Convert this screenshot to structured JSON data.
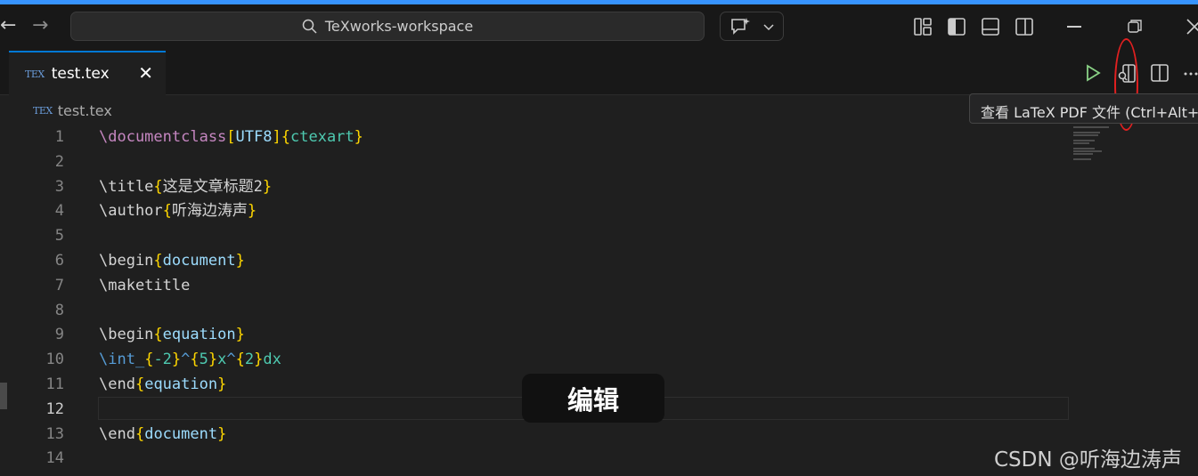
{
  "titlebar": {
    "search_text": "TeXworks-workspace",
    "accent_color": "#3794ff"
  },
  "tab": {
    "badge": "TEX",
    "label": "test.tex",
    "close_glyph": "✕",
    "accent_color": "#0078d4"
  },
  "breadcrumb": {
    "badge": "TEX",
    "file": "test.tex"
  },
  "tooltip": {
    "text": "查看 LaTeX PDF 文件 (Ctrl+Alt+V"
  },
  "code": {
    "lines": [
      {
        "n": "1",
        "segments": [
          [
            "kw",
            "\\documentclass"
          ],
          [
            "br",
            "["
          ],
          [
            "arg",
            "UTF8"
          ],
          [
            "br",
            "]"
          ],
          [
            "br",
            "{"
          ],
          [
            "cls",
            "ctexart"
          ],
          [
            "br",
            "}"
          ]
        ]
      },
      {
        "n": "2",
        "segments": []
      },
      {
        "n": "3",
        "segments": [
          [
            "cmd",
            "\\title"
          ],
          [
            "br",
            "{"
          ],
          [
            "txt",
            "这是文章标题2"
          ],
          [
            "br",
            "}"
          ]
        ]
      },
      {
        "n": "4",
        "segments": [
          [
            "cmd",
            "\\author"
          ],
          [
            "br",
            "{"
          ],
          [
            "txt",
            "听海边涛声"
          ],
          [
            "br",
            "}"
          ]
        ]
      },
      {
        "n": "5",
        "segments": []
      },
      {
        "n": "6",
        "segments": [
          [
            "cmd",
            "\\begin"
          ],
          [
            "br",
            "{"
          ],
          [
            "arg",
            "document"
          ],
          [
            "br",
            "}"
          ]
        ]
      },
      {
        "n": "7",
        "segments": [
          [
            "cmd",
            "\\maketitle"
          ]
        ]
      },
      {
        "n": "8",
        "segments": []
      },
      {
        "n": "9",
        "segments": [
          [
            "cmd",
            "\\begin"
          ],
          [
            "br",
            "{"
          ],
          [
            "arg",
            "equation"
          ],
          [
            "br",
            "}"
          ]
        ]
      },
      {
        "n": "10",
        "segments": [
          [
            "mathcmd",
            "\\int_"
          ],
          [
            "br",
            "{"
          ],
          [
            "mathtxt",
            "-2"
          ],
          [
            "br",
            "}"
          ],
          [
            "mathcmd",
            "^"
          ],
          [
            "br",
            "{"
          ],
          [
            "mathtxt",
            "5"
          ],
          [
            "br",
            "}"
          ],
          [
            "mathtxt",
            "x"
          ],
          [
            "mathcmd",
            "^"
          ],
          [
            "br",
            "{"
          ],
          [
            "mathtxt",
            "2"
          ],
          [
            "br",
            "}"
          ],
          [
            "mathtxt",
            "dx"
          ]
        ]
      },
      {
        "n": "11",
        "segments": [
          [
            "cmd",
            "\\end"
          ],
          [
            "br",
            "{"
          ],
          [
            "arg",
            "equation"
          ],
          [
            "br",
            "}"
          ]
        ]
      },
      {
        "n": "12",
        "segments": [],
        "active": true
      },
      {
        "n": "13",
        "segments": [
          [
            "cmd",
            "\\end"
          ],
          [
            "br",
            "{"
          ],
          [
            "arg",
            "document"
          ],
          [
            "br",
            "}"
          ]
        ]
      },
      {
        "n": "14",
        "segments": []
      }
    ]
  },
  "overlay": {
    "toast": "编辑",
    "watermark": "CSDN @听海边涛声"
  },
  "icons": [
    "arrow-left-icon",
    "arrow-right-icon",
    "search-icon",
    "copilot-chat-icon",
    "chevron-down-icon",
    "customize-layout-icon",
    "toggle-primary-sidebar-icon",
    "toggle-panel-icon",
    "toggle-secondary-sidebar-icon",
    "minimize-icon",
    "restore-icon",
    "close-icon",
    "run-icon",
    "view-pdf-icon",
    "split-editor-icon",
    "more-actions-icon"
  ]
}
